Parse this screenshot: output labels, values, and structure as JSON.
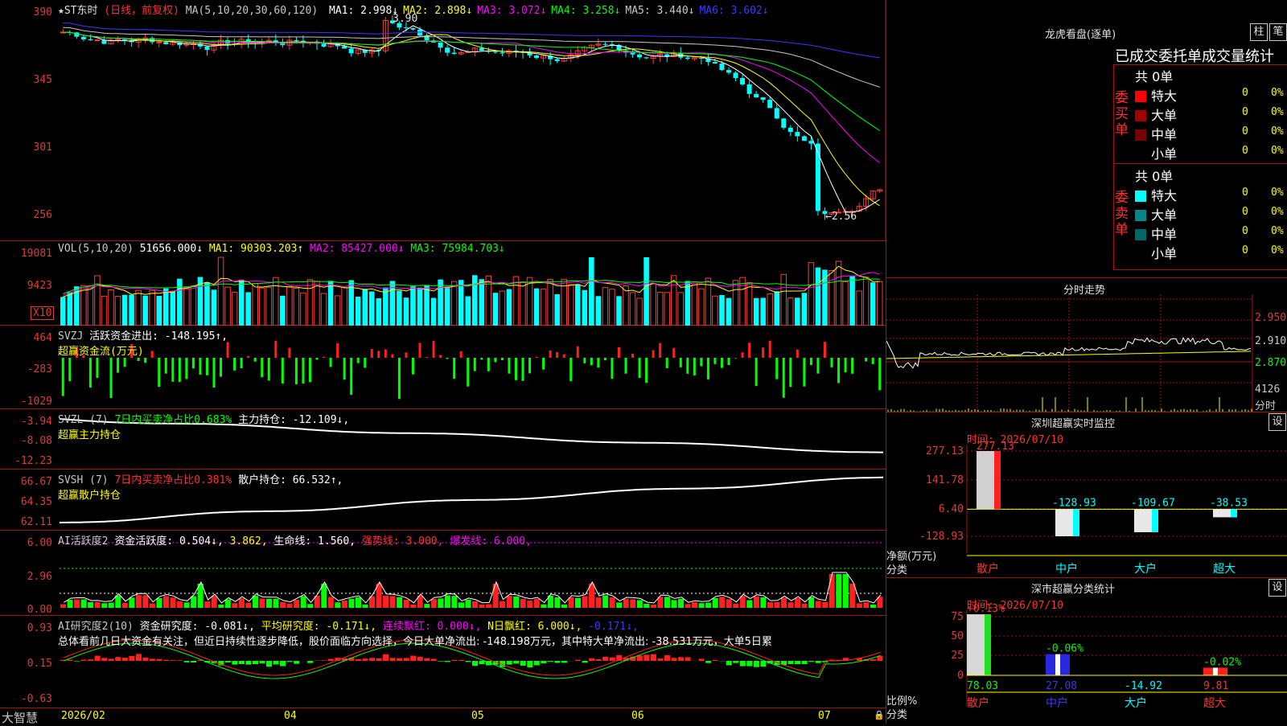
{
  "main": {
    "title": "★ST东时",
    "mode": "(日线，前复权)",
    "ma_label": "MA(5,10,20,30,60,120)",
    "ma": [
      {
        "name": "MA1:",
        "value": "2.998↓",
        "color": "#ffffff"
      },
      {
        "name": "MA2:",
        "value": "2.898↓",
        "color": "#ffff00"
      },
      {
        "name": "MA3:",
        "value": "3.072↓",
        "color": "#ff00ff"
      },
      {
        "name": "MA4:",
        "value": "3.258↓",
        "color": "#00ff00"
      },
      {
        "name": "MA5:",
        "value": "3.440↓",
        "color": "#c8c8c8"
      },
      {
        "name": "MA6:",
        "value": "3.602↓",
        "color": "#3a3aff"
      }
    ],
    "axis": [
      "390",
      "345",
      "301",
      "256"
    ],
    "high_mark": "3.90",
    "low_mark": "←2.56"
  },
  "vol": {
    "label": "VOL(5,10,20)",
    "value": "51656.000↓",
    "ma1": "MA1: 90303.203↑",
    "ma2": "MA2: 85427.000↓",
    "ma3": "MA3: 75984.703↓",
    "axis": [
      "19081",
      "9423"
    ],
    "unit": "X10"
  },
  "svzj": {
    "label": "SVZJ",
    "text": "活跃资金进出: -148.195↑,",
    "sub": "超赢资金流(万元)",
    "axis": [
      "464",
      "-283",
      "-1029"
    ]
  },
  "svzl": {
    "label": "SVZL (7)",
    "text1": "7日内买卖净占比0.683%",
    "text2": "主力持仓: -12.109↓,",
    "sub": "超赢主力持仓",
    "axis": [
      "-3.94",
      "-8.08",
      "-12.23"
    ]
  },
  "svsh": {
    "label": "SVSH (7)",
    "text1": "7日内买卖净占比0.381%",
    "text2": "散户持仓: 66.532↑,",
    "sub": "超赢散户持仓",
    "axis": [
      "66.67",
      "64.35",
      "62.11"
    ]
  },
  "ai1": {
    "label": "AI活跃度2",
    "t1": "资金活跃度: 0.504↓,",
    "t2": "3.862,",
    "t3": "生命线: 1.560,",
    "t4": "强势线: 3.000,",
    "t5": "爆发线: 6.000,",
    "axis": [
      "6.00",
      "2.96",
      "0.00"
    ]
  },
  "ai2": {
    "label": "AI研究度2(10)",
    "t1": "资金研究度: -0.081↓,",
    "t2": "平均研究度: -0.171↓,",
    "t3": "连续飘红: 0.000↓,",
    "t4": "N日飘红: 6.000↓,",
    "t5": "-0.171↓,",
    "comment": "总体看前几日大资金有关注，但近日持续性逐步降低，股价面临方向选择，今日大单净流出: -148.198万元，其中特大单净流出: -38.531万元，大单5日累",
    "axis": [
      "0.93",
      "0.15",
      "-0.63"
    ]
  },
  "xaxis": {
    "brand": "大智慧",
    "labels": [
      "2026/02",
      "04",
      "05",
      "06",
      "07"
    ]
  },
  "dragon": {
    "title": "龙虎看盘(逐单)",
    "btn1": "柱",
    "btn2": "笔",
    "subtitle": "已成交委托单成交量统计",
    "buy_label": "委买单",
    "sell_label": "委卖单",
    "buy_total": "共 0单",
    "sell_total": "共 0单",
    "buy_rows": [
      {
        "name": "特大",
        "count": "0",
        "pct": "0%",
        "color": "#ff0000"
      },
      {
        "name": "大单",
        "count": "0",
        "pct": "0%",
        "color": "#a00000"
      },
      {
        "name": "中单",
        "count": "0",
        "pct": "0%",
        "color": "#780000"
      },
      {
        "name": "小单",
        "count": "0",
        "pct": "0%",
        "color": ""
      }
    ],
    "sell_rows": [
      {
        "name": "特大",
        "count": "0",
        "pct": "0%",
        "color": "#00ffff"
      },
      {
        "name": "大单",
        "count": "0",
        "pct": "0%",
        "color": "#008888"
      },
      {
        "name": "中单",
        "count": "0",
        "pct": "0%",
        "color": "#006868"
      },
      {
        "name": "小单",
        "count": "0",
        "pct": "0%",
        "color": ""
      }
    ]
  },
  "intraday": {
    "title": "分时走势",
    "axis": [
      "2.950",
      "2.910",
      "2.870",
      "4126",
      "分时"
    ]
  },
  "monitor": {
    "title": "深圳超赢实时监控",
    "btn": "设",
    "time": "时间: 2026/07/10",
    "axis": [
      "277.13",
      "141.78",
      "6.40",
      "-128.93"
    ],
    "side1": "净额(万元)",
    "side2": "分类",
    "categories": [
      "散户",
      "中户",
      "大户",
      "超大"
    ],
    "values": [
      277.13,
      -128.93,
      -109.67,
      -38.53
    ],
    "value_labels": [
      "277.13",
      "-128.93",
      "-109.67",
      "-38.53"
    ]
  },
  "classify": {
    "title": "深市超赢分类统计",
    "btn": "设",
    "time": "时间: 2026/07/10",
    "axis": [
      "75",
      "50",
      "25",
      "0"
    ],
    "side1": "比例%",
    "side2": "分类",
    "categories": [
      "散户",
      "中户",
      "大户",
      "超大"
    ],
    "top_labels": [
      "+0.13%",
      "-0.06%",
      "",
      "-0.02%"
    ],
    "bottom_labels": [
      "78.03",
      "27.08",
      "-14.92",
      "9.81"
    ],
    "values": [
      78.03,
      27.08,
      -14.92,
      9.81
    ]
  }
}
